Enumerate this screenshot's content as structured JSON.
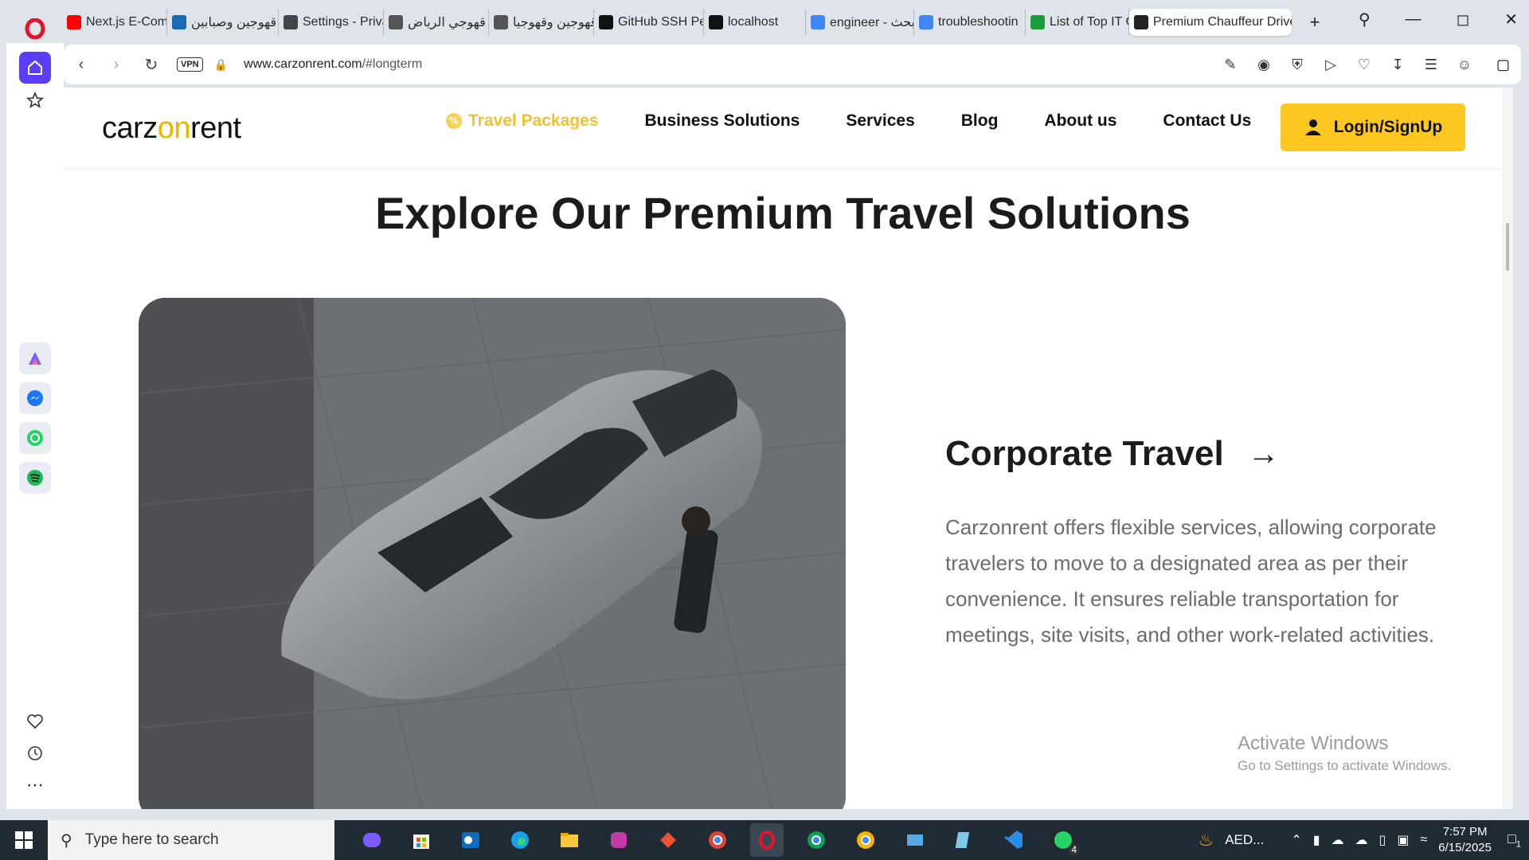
{
  "browser": {
    "tabs": [
      {
        "title": "Next.js E-Comm",
        "fav": "youtube-icon",
        "color": "#ff0000"
      },
      {
        "title": "قهوجين وصبابين",
        "fav": "site-icon",
        "color": "#1a6bb5"
      },
      {
        "title": "Settings - Priva",
        "fav": "gear-icon",
        "color": "#444444"
      },
      {
        "title": "قهوجي الرياض",
        "fav": "site-icon",
        "color": "#555555"
      },
      {
        "title": "قهوجين وقهوجيا",
        "fav": "globe-icon",
        "color": "#555555"
      },
      {
        "title": "GitHub SSH Pe",
        "fav": "openai-icon",
        "color": "#111111"
      },
      {
        "title": "localhost",
        "fav": "site-icon",
        "color": "#111111"
      },
      {
        "title": "engineer - بحث",
        "fav": "google-icon",
        "color": "#4285f4"
      },
      {
        "title": "troubleshootin",
        "fav": "google-icon",
        "color": "#4285f4"
      },
      {
        "title": "List of Top IT C",
        "fav": "site-icon",
        "color": "#1a9c3a"
      },
      {
        "title": "Premium Chauffeur Drive",
        "fav": "site-icon",
        "color": "#222222",
        "active": true
      }
    ],
    "vpn_label": "VPN",
    "url_domain": "www.carzonrent.com",
    "url_path": "/#longterm"
  },
  "site": {
    "logo_a": "carz",
    "logo_b": "on",
    "logo_c": "rent",
    "menu": {
      "travel": "Travel Packages",
      "business": "Business Solutions",
      "services": "Services",
      "blog": "Blog",
      "about": "About us",
      "contact": "Contact Us"
    },
    "login": "Login/SignUp",
    "section_title": "Explore Our Premium Travel Solutions",
    "card_title": "Corporate Travel",
    "card_arrow": "→",
    "card_text": "Carzonrent offers flexible services, allowing corporate travelers to move to a designated area as per their convenience. It ensures reliable transportation for meetings, site visits, and other work-related activities."
  },
  "watermark": {
    "line1": "Activate Windows",
    "line2": "Go to Settings to activate Windows."
  },
  "taskbar": {
    "search_placeholder": "Type here to search",
    "tray_text": "AED...",
    "time": "7:57 PM",
    "date": "6/15/2025",
    "notification_count": "1",
    "whatsapp_badge": "4"
  },
  "colors": {
    "accent": "#ffc820",
    "travel_link": "#f2c12e",
    "opera_red": "#e3132c",
    "sidebar_active": "#5b3df5"
  }
}
